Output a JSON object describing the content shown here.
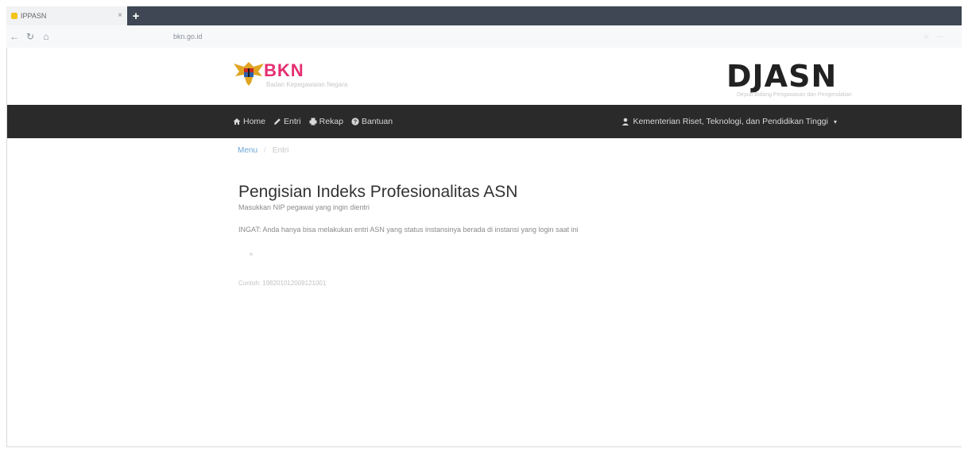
{
  "browser": {
    "tab_title": "IPPASN",
    "tab_close": "×",
    "new_tab": "+",
    "url": "bkn.go.id"
  },
  "header": {
    "bkn_title": "BKN",
    "bkn_subtitle": "Badan Kepegawaian Negara",
    "djasn_title": "DJASN",
    "djasn_subtitle": "Deputi Bidang Pengawasan dan Pengendalian"
  },
  "nav": {
    "items": [
      {
        "label": "Home",
        "icon": "home-icon"
      },
      {
        "label": "Entri",
        "icon": "pencil-icon"
      },
      {
        "label": "Rekap",
        "icon": "print-icon"
      },
      {
        "label": "Bantuan",
        "icon": "question-circle-icon"
      }
    ],
    "user_label": "Kementerian Riset, Teknologi, dan Pendidikan Tinggi",
    "user_icon": "user-icon",
    "caret": "▾"
  },
  "breadcrumb": {
    "items": [
      "Menu",
      "Entri"
    ],
    "separator": "/"
  },
  "main": {
    "title": "Pengisian Indeks Profesionalitas ASN",
    "lead": "Masukkan NIP pegawai yang ingin dientri",
    "note": "INGAT: Anda hanya bisa melakukan entri ASN yang status instansinya berada di instansi yang login saat ini",
    "input_placeholder": "",
    "hint": "Contoh: 198201012009121001"
  },
  "colors": {
    "nav_bg": "#2a2a2a",
    "bkn_accent": "#e52e71",
    "link": "#6ea6d8"
  }
}
